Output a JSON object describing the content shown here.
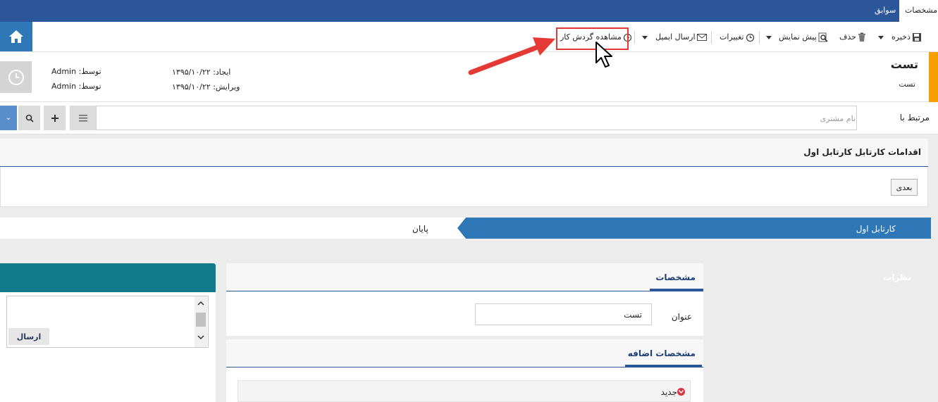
{
  "tabs": {
    "specs": "مشخصات",
    "history": "سوابق"
  },
  "toolbar": {
    "save": "ذخیره",
    "delete": "حذف",
    "preview": "پیش نمایش",
    "changes": "تغییرات",
    "send_email": "ارسال ایمیل",
    "view_workflow": "مشاهده گردش کار"
  },
  "record": {
    "title": "تست",
    "subtitle": "تست",
    "created_label": "ایجاد:",
    "created_date": "۱۳۹۵/۱۰/۲۲",
    "edited_label": "ویرایش:",
    "edited_date": "۱۳۹۵/۱۰/۲۲",
    "by_label": "توسط:",
    "created_by": "Admin",
    "edited_by": "Admin"
  },
  "related": {
    "label": "مرتبط با",
    "placeholder": "نام مشتری"
  },
  "actions": {
    "title": "اقدامات کارتابل کارتابل اول",
    "next_button": "بعدی"
  },
  "workflow": {
    "steps": [
      "کارتابل اول",
      "پایان"
    ]
  },
  "comments": {
    "title": "نظرات",
    "send_button": "ارسال"
  },
  "specs": {
    "title": "مشخصات",
    "field_label": "عنوان",
    "field_value": "تست"
  },
  "extra_specs": {
    "title": "مشخصات اضافه",
    "new_label": "جدید"
  },
  "colors": {
    "primary": "#2b579a",
    "accent": "#2e78b7",
    "warning": "#f5a000",
    "teal": "#117a8b",
    "highlight": "#e53935"
  }
}
